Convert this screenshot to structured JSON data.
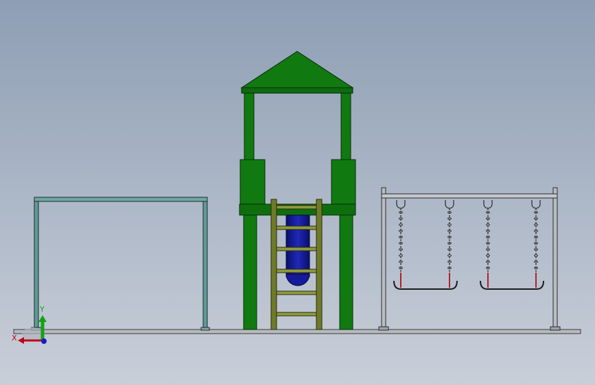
{
  "viewport": {
    "background_top": "#8e9eb4",
    "background_bottom": "#c9cfd9"
  },
  "triad": {
    "x_label": "X",
    "y_label": "Y",
    "x_color": "#c0001a",
    "y_color": "#12a312",
    "z_color": "#1a1ad0"
  },
  "colors": {
    "tower_green": "#107a10",
    "tower_green_dark": "#0d5a0d",
    "slide_blue": "#131898",
    "ladder_olive": "#6e7a2a",
    "ladder_rung": "#8f9a3e",
    "bar_teal": "#5f9a96",
    "swing_frame": "#b9bdc2",
    "rope_red": "#b0202a",
    "ground": "#b7babd"
  }
}
